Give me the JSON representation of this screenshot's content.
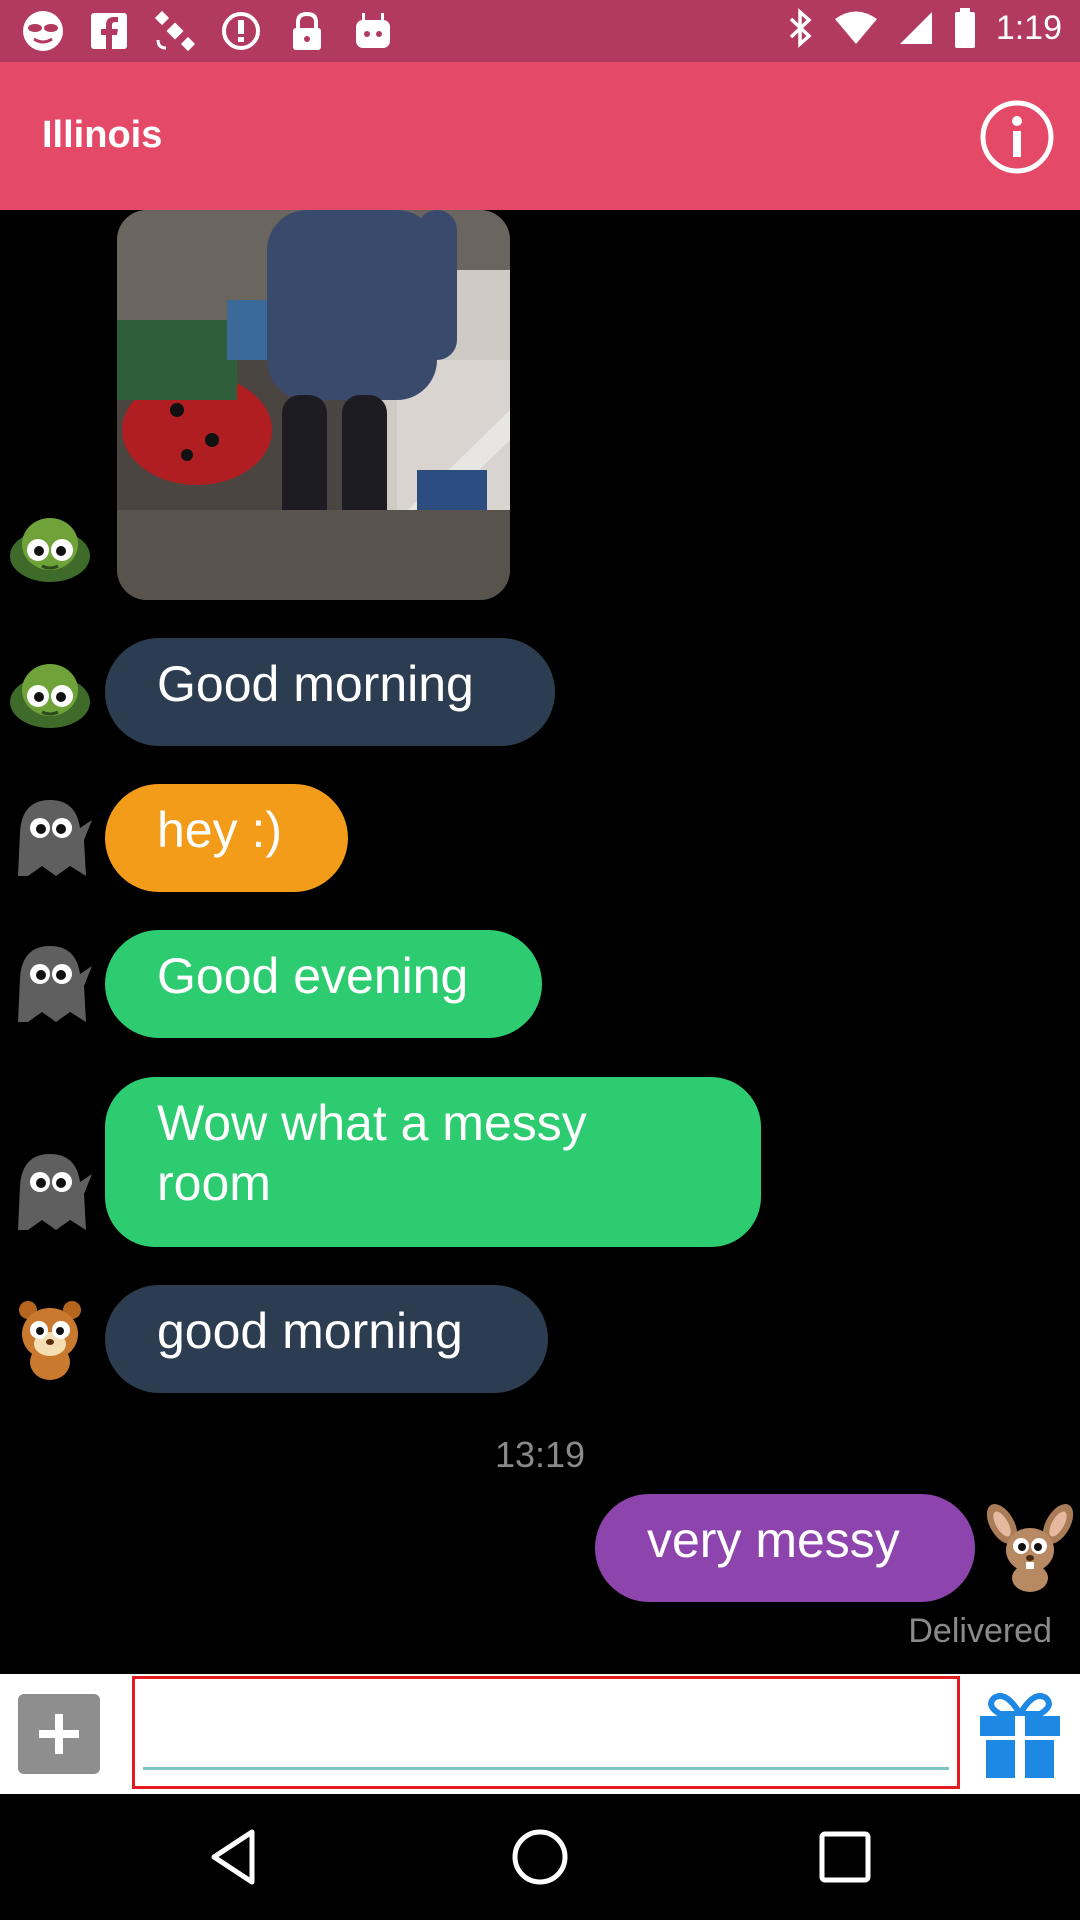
{
  "status_bar": {
    "time": "1:19",
    "left_icons": [
      "mask-icon",
      "facebook-icon",
      "satellite-icon",
      "alert-icon",
      "lock-icon",
      "android-icon"
    ],
    "right_icons": [
      "bluetooth-icon",
      "wifi-icon",
      "cell-signal-icon",
      "battery-icon"
    ]
  },
  "app_bar": {
    "title": "Illinois",
    "info_icon": "info-icon"
  },
  "messages": [
    {
      "type": "image",
      "avatar": "turtle-avatar"
    },
    {
      "type": "text",
      "avatar": "turtle-avatar",
      "text": "Good morning",
      "color": "#2c3d51"
    },
    {
      "type": "text",
      "avatar": "ghost-avatar",
      "text": "hey :)",
      "color": "#f39c1a"
    },
    {
      "type": "text",
      "avatar": "ghost-avatar",
      "text": "Good evening",
      "color": "#2ecc71"
    },
    {
      "type": "text",
      "avatar": "ghost-avatar",
      "text": "Wow what a messy room",
      "color": "#2ecc71"
    },
    {
      "type": "text",
      "avatar": "hamster-avatar",
      "text": "good morning",
      "color": "#2c3d51"
    }
  ],
  "timestamp": "13:19",
  "outgoing": {
    "text": "very messy",
    "avatar": "rabbit-avatar",
    "color": "#8e44ad",
    "status": "Delivered"
  },
  "composer": {
    "input_value": "",
    "placeholder": "",
    "add_icon": "plus-icon",
    "gift_icon": "gift-icon"
  },
  "nav_bar": {
    "icons": [
      "back-icon",
      "home-icon",
      "recents-icon"
    ]
  }
}
